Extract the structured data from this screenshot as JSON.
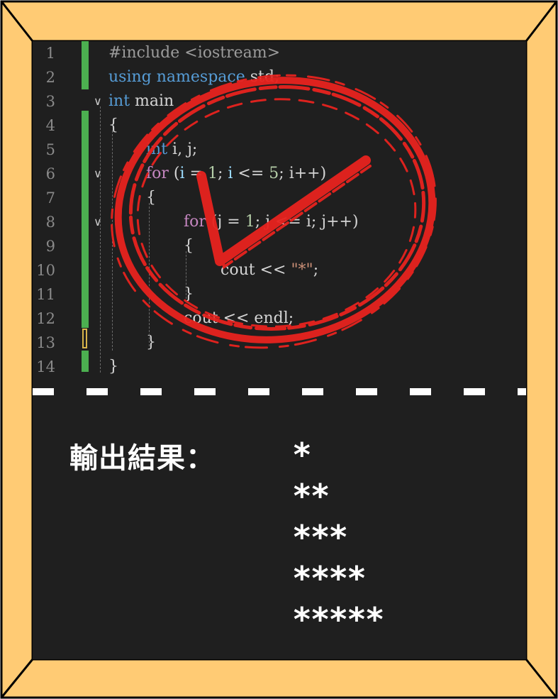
{
  "code_lines": [
    {
      "n": "1",
      "tokens": [
        {
          "t": "#include <iostream>",
          "c": "pre"
        }
      ]
    },
    {
      "n": "2",
      "tokens": [
        {
          "t": "using ",
          "c": "kw"
        },
        {
          "t": "namespace ",
          "c": "kw"
        },
        {
          "t": "std;",
          "c": "plain"
        }
      ]
    },
    {
      "n": "3",
      "tokens": [
        {
          "t": "int ",
          "c": "kw"
        },
        {
          "t": "main",
          "c": "plain"
        }
      ]
    },
    {
      "n": "4",
      "tokens": [
        {
          "t": "{",
          "c": "plain"
        }
      ]
    },
    {
      "n": "5",
      "tokens": [
        {
          "t": "int ",
          "c": "kw"
        },
        {
          "t": "i, j;",
          "c": "plain"
        }
      ]
    },
    {
      "n": "6",
      "tokens": [
        {
          "t": "for ",
          "c": "ctl"
        },
        {
          "t": "(",
          "c": "plain"
        },
        {
          "t": "i",
          "c": "var"
        },
        {
          "t": " = ",
          "c": "plain"
        },
        {
          "t": "1",
          "c": "num"
        },
        {
          "t": "; ",
          "c": "plain"
        },
        {
          "t": "i",
          "c": "var"
        },
        {
          "t": " <= ",
          "c": "plain"
        },
        {
          "t": "5",
          "c": "num"
        },
        {
          "t": "; ",
          "c": "plain"
        },
        {
          "t": "i++)",
          "c": "plain"
        }
      ]
    },
    {
      "n": "7",
      "tokens": [
        {
          "t": "{",
          "c": "plain"
        }
      ]
    },
    {
      "n": "8",
      "tokens": [
        {
          "t": "for ",
          "c": "ctl"
        },
        {
          "t": "(j = ",
          "c": "plain"
        },
        {
          "t": "1",
          "c": "num"
        },
        {
          "t": "; j <= i; j++)",
          "c": "plain"
        }
      ]
    },
    {
      "n": "9",
      "tokens": [
        {
          "t": "{",
          "c": "plain"
        }
      ]
    },
    {
      "n": "10",
      "tokens": [
        {
          "t": "cout << ",
          "c": "plain"
        },
        {
          "t": "\"*\"",
          "c": "str"
        },
        {
          "t": ";",
          "c": "plain"
        }
      ]
    },
    {
      "n": "11",
      "tokens": [
        {
          "t": "}",
          "c": "plain"
        }
      ]
    },
    {
      "n": "12",
      "tokens": [
        {
          "t": "cout << endl;",
          "c": "plain"
        }
      ]
    },
    {
      "n": "13",
      "tokens": [
        {
          "t": "}",
          "c": "plain"
        }
      ]
    },
    {
      "n": "14",
      "tokens": [
        {
          "t": "}",
          "c": "plain"
        }
      ]
    }
  ],
  "output": {
    "label": "輸出結果：",
    "rows": [
      "*",
      "**",
      "***",
      "****",
      "*****"
    ]
  },
  "colors": {
    "frame": "#ffcb74",
    "board": "#1f1f1f",
    "stamp": "#e8231e",
    "gutter_modified": "#4caf50"
  },
  "icons": [
    "fold-chevron-icon",
    "check-stamp-icon"
  ]
}
